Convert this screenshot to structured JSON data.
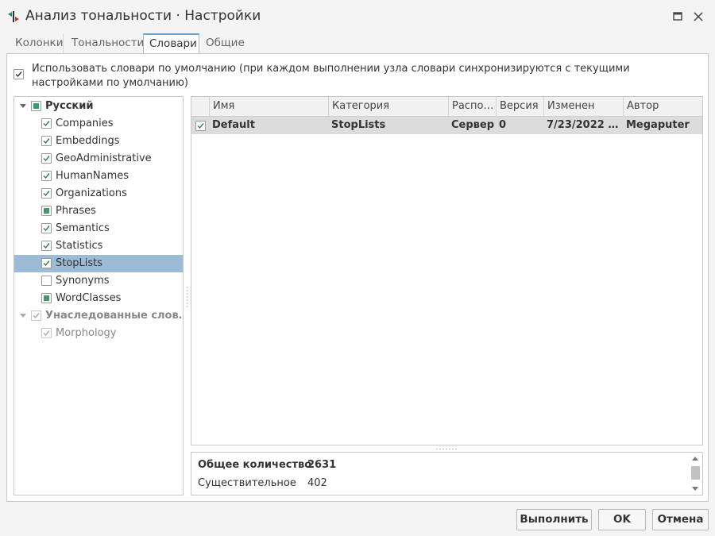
{
  "window": {
    "title": "Анализ тональности · Настройки"
  },
  "tabs": [
    {
      "label": "Колонки",
      "active": false
    },
    {
      "label": "Тональности",
      "active": false
    },
    {
      "label": "Словари",
      "active": true
    },
    {
      "label": "Общие",
      "active": false
    }
  ],
  "use_default": {
    "checked": true,
    "label": "Использовать словари по умолчанию (при каждом выполнении узла словари синхронизируются с текущими настройками по умолчанию)"
  },
  "tree": {
    "groups": [
      {
        "label": "Русский",
        "state": "partial",
        "expanded": true,
        "items": [
          {
            "label": "Companies",
            "state": "checked"
          },
          {
            "label": "Embeddings",
            "state": "checked"
          },
          {
            "label": "GeoAdministrative",
            "state": "checked"
          },
          {
            "label": "HumanNames",
            "state": "checked"
          },
          {
            "label": "Organizations",
            "state": "checked"
          },
          {
            "label": "Phrases",
            "state": "partial"
          },
          {
            "label": "Semantics",
            "state": "checked"
          },
          {
            "label": "Statistics",
            "state": "checked"
          },
          {
            "label": "StopLists",
            "state": "checked",
            "selected": true
          },
          {
            "label": "Synonyms",
            "state": "unchecked"
          },
          {
            "label": "WordClasses",
            "state": "partial"
          }
        ]
      },
      {
        "label": "Унаследованные слов…",
        "state": "checked-disabled",
        "expanded": true,
        "items": [
          {
            "label": "Morphology",
            "state": "checked-disabled"
          }
        ]
      }
    ]
  },
  "grid": {
    "columns": [
      "Имя",
      "Категория",
      "Распо…",
      "Версия",
      "Изменен",
      "Автор"
    ],
    "rows": [
      {
        "checked": true,
        "cells": [
          "Default",
          "StopLists",
          "Сервер",
          "0",
          "7/23/2022 1...",
          "Megaputer"
        ]
      }
    ]
  },
  "stats": {
    "rows": [
      {
        "key": "Общее количество",
        "value": "2631",
        "bold": true
      },
      {
        "key": "Существительное",
        "value": "402",
        "bold": false
      }
    ]
  },
  "buttons": {
    "run": "Выполнить",
    "ok": "OK",
    "cancel": "Отмена"
  },
  "colors": {
    "accent": "#6aa1cf",
    "selection": "#9bbbd6",
    "partial_check": "#3f9a6a",
    "check_mark": "#2f7d52"
  }
}
